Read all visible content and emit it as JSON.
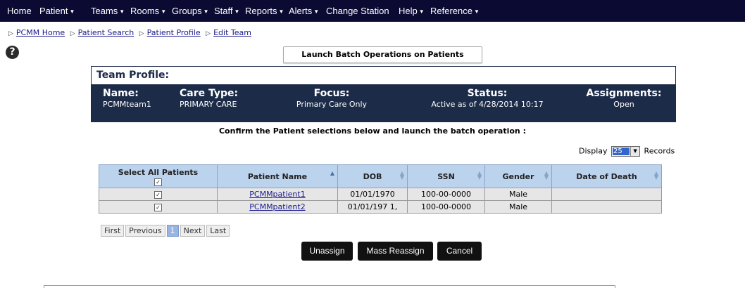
{
  "nav": {
    "items": [
      {
        "label": "Home",
        "caret": false
      },
      {
        "label": "Patient",
        "caret": true
      },
      {
        "label": "Teams",
        "caret": true
      },
      {
        "label": "Rooms",
        "caret": true
      },
      {
        "label": "Groups",
        "caret": true
      },
      {
        "label": "Staff",
        "caret": true
      },
      {
        "label": "Reports",
        "caret": true
      },
      {
        "label": "Alerts",
        "caret": true
      },
      {
        "label": "Change Station",
        "caret": false
      },
      {
        "label": "Help",
        "caret": true
      },
      {
        "label": "Reference",
        "caret": true
      }
    ]
  },
  "breadcrumb": [
    "PCMM Home",
    "Patient Search",
    "Patient Profile",
    "Edit Team"
  ],
  "launch_label": "Launch Batch Operations on Patients",
  "profile": {
    "title": "Team Profile:",
    "name": {
      "label": "Name:",
      "value": "PCMMteam1"
    },
    "care_type": {
      "label": "Care Type:",
      "value": "PRIMARY CARE"
    },
    "focus": {
      "label": "Focus:",
      "value": "Primary Care Only"
    },
    "status": {
      "label": "Status:",
      "value": "Active as of 4/28/2014 10:17"
    },
    "assignments": {
      "label": "Assignments:",
      "value": "Open"
    }
  },
  "confirm_text": "Confirm the Patient selections below and launch the batch operation :",
  "display": {
    "prefix": "Display",
    "value": "25",
    "suffix": "Records"
  },
  "table": {
    "select_all_label": "Select All Patients",
    "columns": [
      "Patient Name",
      "DOB",
      "SSN",
      "Gender",
      "Date of Death"
    ],
    "rows": [
      {
        "name": "PCMMpatient1",
        "dob": "01/01/1970",
        "ssn": "100-00-0000",
        "gender": "Male",
        "dod": ""
      },
      {
        "name": "PCMMpatient2",
        "dob": "01/01/197 1,",
        "ssn": "100-00-0000",
        "gender": "Male",
        "dod": ""
      }
    ]
  },
  "pager": {
    "first": "First",
    "previous": "Previous",
    "current": "1",
    "next": "Next",
    "last": "Last"
  },
  "actions": {
    "unassign": "Unassign",
    "mass_reassign": "Mass Reassign",
    "cancel": "Cancel"
  },
  "colors": {
    "nav_bg": "#0a0a32",
    "profile_bg": "#1c2b48",
    "header_bg": "#bcd3ee",
    "button_bg": "#111111"
  }
}
